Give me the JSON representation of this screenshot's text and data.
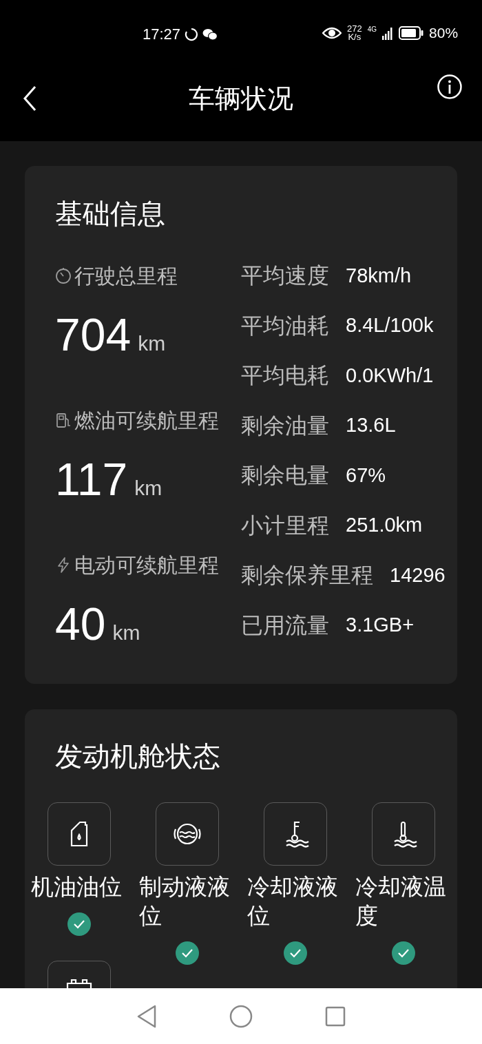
{
  "status_bar": {
    "time": "17:27",
    "speed_value": "272",
    "speed_unit": "K/s",
    "network": "4G",
    "battery": "80%"
  },
  "header": {
    "title": "车辆状况"
  },
  "basic_info": {
    "title": "基础信息",
    "ranges": [
      {
        "kind": "odometer",
        "label": "行驶总里程",
        "value": "704",
        "unit": "km"
      },
      {
        "kind": "fuel",
        "label": "燃油可续航里程",
        "value": "117",
        "unit": "km"
      },
      {
        "kind": "electric",
        "label": "电动可续航里程",
        "value": "40",
        "unit": "km"
      }
    ],
    "stats": [
      {
        "label": "平均速度",
        "value": "78km/h"
      },
      {
        "label": "平均油耗",
        "value": "8.4L/100k"
      },
      {
        "label": "平均电耗",
        "value": "0.0KWh/1"
      },
      {
        "label": "剩余油量",
        "value": "13.6L"
      },
      {
        "label": "剩余电量",
        "value": "67%"
      },
      {
        "label": "小计里程",
        "value": "251.0km"
      },
      {
        "label": "剩余保养里程",
        "value": "14296"
      },
      {
        "label": "已用流量",
        "value": "3.1GB+"
      }
    ]
  },
  "engine_bay": {
    "title": "发动机舱状态",
    "items": [
      {
        "kind": "full",
        "label": "机油油位",
        "ok": true
      },
      {
        "kind": "full",
        "label": "制动液液位",
        "ok": true
      },
      {
        "kind": "full",
        "label": "冷却液液位",
        "ok": true
      },
      {
        "kind": "full",
        "label": "冷却液温度",
        "ok": true
      },
      {
        "kind": "partial"
      }
    ]
  }
}
